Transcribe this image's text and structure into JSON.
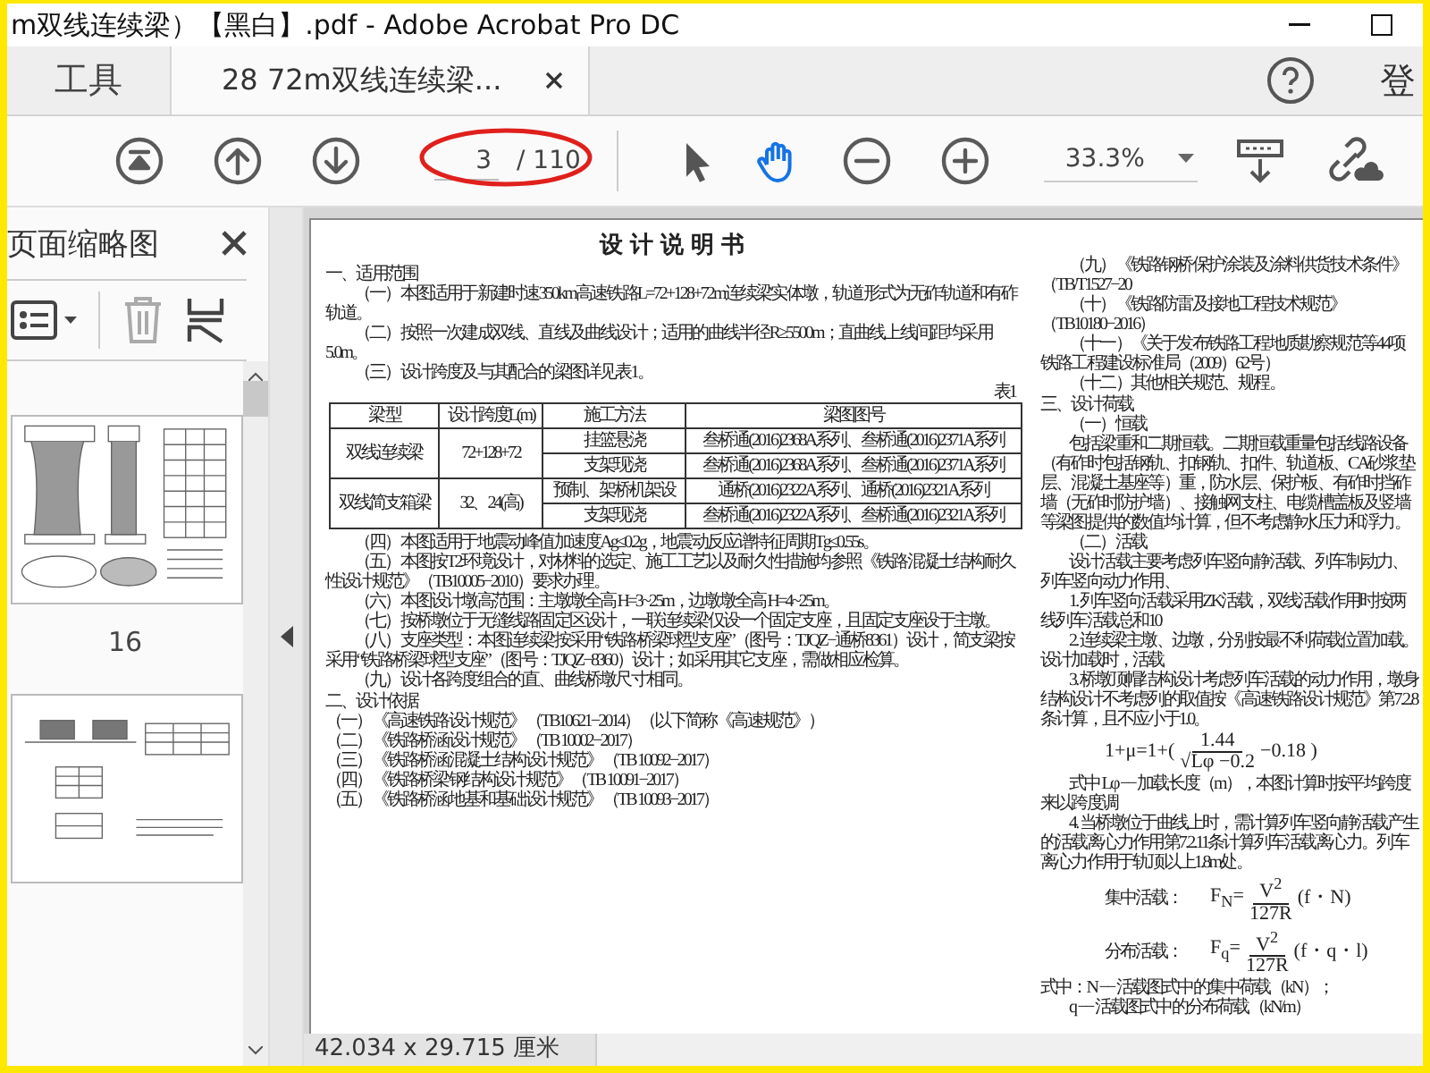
{
  "window": {
    "title": "m双线连续梁）【黑白】.pdf - Adobe Acrobat Pro DC"
  },
  "tabs": [
    {
      "label": "工具",
      "selected": false
    },
    {
      "label": "28 72m双线连续梁...",
      "selected": true
    }
  ],
  "account": {
    "label": "登"
  },
  "toolbar": {
    "page_number": "3",
    "page_total": "/ 110",
    "zoom": "33.3%",
    "tools": [
      {
        "kind": "select",
        "selected": false
      },
      {
        "kind": "hand",
        "selected": true
      }
    ]
  },
  "thumbnails_panel": {
    "title": "页面缩略图",
    "pages": [
      {
        "kind": "pier",
        "label": "16"
      },
      {
        "kind": "bearing"
      }
    ]
  },
  "document": {
    "title": "设计说明书",
    "left": [
      {
        "kind": "heading",
        "text": "一、适用范围"
      },
      {
        "kind": "para",
        "text": "（一）本图适用于新建时速350km高速铁路L=72+128+72m连续梁实体墩，轨道形式为无砟轨道和有砟轨道。"
      },
      {
        "kind": "para",
        "text": "（二）按照一次建成双线、直线及曲线设计；适用的曲线半径R≥5500m；直曲线上线间距均采用5.0m。"
      },
      {
        "kind": "para",
        "text": "（三）设计跨度及与其配合的梁图详见表1。"
      },
      {
        "kind": "table",
        "caption": "表1",
        "columns": [
          "梁 型",
          "设计跨度L(m)",
          "施工方法",
          "梁图图号"
        ],
        "groups": [
          {
            "type": "双线连续梁",
            "span": "72+128+72",
            "methods": [
              {
                "method": "挂篮悬浇",
                "drawings": "叁桥通(2016)2368A系列、叁桥通(2016)2371A系列"
              },
              {
                "method": "支架现浇",
                "drawings": "叁桥通(2016)2368A系列、叁桥通(2016)2371A系列"
              }
            ]
          },
          {
            "type": "双线简支箱梁",
            "span": "32、24(高)",
            "methods": [
              {
                "method": "预制、架桥机架设",
                "drawings": "通桥(2016)2322A系列、通桥(2016)2321A系列"
              },
              {
                "method": "支架现浇",
                "drawings": "叁桥通(2016)2322A系列、叁桥通(2016)2321A系列"
              }
            ]
          }
        ]
      },
      {
        "kind": "para",
        "text": "（四）本图适用于地震动峰值加速度Ag≤0.2g，地震动反应谱特征周期Tg≤0.55s。"
      },
      {
        "kind": "para",
        "text": "（五）本图按T2环境设计，对材料的选定、施工工艺以及耐久性措施均参照《铁路混凝土结构耐久性设计规范》（TB10005−2010）要求办理。"
      },
      {
        "kind": "para",
        "text": "（六）本图设计墩高范围：主墩墩全高 H=3~25m，边墩墩全高 H=4~25m。"
      },
      {
        "kind": "para",
        "text": "（七）按桥墩位于无缝线路固定区设计，一联连续梁仅设一个固定支座，且固定支座设于主墩。"
      },
      {
        "kind": "para",
        "text": "（八）支座类型：本图连续梁按采用“铁路桥梁球型支座”（图号：TJQZ−通桥8361）设计，简支梁按采用“铁路桥梁球型支座”（图号：TJQZ−8360）设计；如采用其它支座，需做相应检算。"
      },
      {
        "kind": "para",
        "text": "（九）设计各跨度组合的直、曲线桥墩尺寸相同。"
      },
      {
        "kind": "heading",
        "text": "二、设计依据"
      },
      {
        "kind": "line",
        "text": "（一）《高速铁路设计规范》（TB10621−2014）（以下简称《高速规范》）"
      },
      {
        "kind": "line",
        "text": "（二）《铁路桥涵设计规范》（TB 10002−2017）"
      },
      {
        "kind": "line",
        "text": "（三）《铁路桥涵混凝土结构设计规范》（TB 10092−2017）"
      },
      {
        "kind": "line",
        "text": "（四）《铁路桥梁钢结构设计规范》（TB 10091−2017）"
      },
      {
        "kind": "line",
        "text": "（五）《铁路桥涵地基和基础设计规范》（TB 10093−2017）"
      }
    ],
    "right": [
      {
        "kind": "para",
        "text": "（九）《铁路钢桥保护涂装及涂料供货技术条件》（TB/T1527−20"
      },
      {
        "kind": "para",
        "text": "（十）《铁路防雷及接地工程技术规范》（TB10180−2016）"
      },
      {
        "kind": "para",
        "text": "（十一）《关于发布铁路工程地质勘察规范等44项铁路工程建设标准局（2009）62号）"
      },
      {
        "kind": "para",
        "text": "（十二）其他相关规范、规程。"
      },
      {
        "kind": "heading",
        "text": "三、设计荷载"
      },
      {
        "kind": "para",
        "text": "（一）恒载"
      },
      {
        "kind": "para",
        "text": "包括梁重和二期恒载。二期恒载重量包括线路设备（有砟时包括钢轨、扣钢轨、扣件、轨道板、CA砂浆垫层、混凝土基座等）重，防水层、保护板、有砟时挡砟墙（无砟时防护墙）、接触网支柱、电缆槽盖板及竖墙等梁图提供的数值均计算，但不考虑静水压力和浮力。"
      },
      {
        "kind": "para",
        "text": "（二）活载"
      },
      {
        "kind": "para",
        "text": "设计活载主要考虑列车竖向静活载、列车制动力、列车竖向动力作用、"
      },
      {
        "kind": "para",
        "text": "1. 列车竖向活载采用ZK活载，双线活载作用时按两线列车活载总和10"
      },
      {
        "kind": "para",
        "text": "2. 连续梁主墩、边墩，分别按最不利荷载位置加载。设计加载时，活载"
      },
      {
        "kind": "para",
        "text": "3. 桥墩顶帽结构设计考虑列车活载的动力作用，墩身结构设计不考虑列的取值按《高速铁路设计规范》第7.2.8条计算，且不应小于1.0。"
      },
      {
        "kind": "formula",
        "lhs": "1+μ=1+(",
        "numerator": "1.44",
        "denominator": "√Lφ −0.2",
        "rhs": "−0.18 )"
      },
      {
        "kind": "para",
        "text": "式中 Lφ −− 加载长度（m），本图计算时按平均跨度来以跨度调"
      },
      {
        "kind": "para",
        "text": "4. 当桥墩位于曲线上时，需计算列车竖向静活载产生的活载离心力作用第7.2.11条计算列车活载离心力。列车离心力作用于轨顶以上1.8m处。"
      },
      {
        "kind": "formula",
        "label": "集中活载：",
        "lhs": "F$_{N}$=",
        "numerator": "V$^{2}$",
        "denominator": "127R",
        "rhs": "(f・N)"
      },
      {
        "kind": "formula",
        "label": "分布活载：",
        "lhs": "F$_{q}$=",
        "numerator": "V$^{2}$",
        "denominator": "127R",
        "rhs": "(f・q・l)"
      },
      {
        "kind": "line",
        "text": "式中：N −− 活载图式中的集中荷载（kN）；"
      },
      {
        "kind": "para",
        "text": "q −− 活载图式中的分布荷载（kN/m）"
      }
    ]
  },
  "status_bar": {
    "page_size": "42.034 x 29.715 厘米"
  }
}
